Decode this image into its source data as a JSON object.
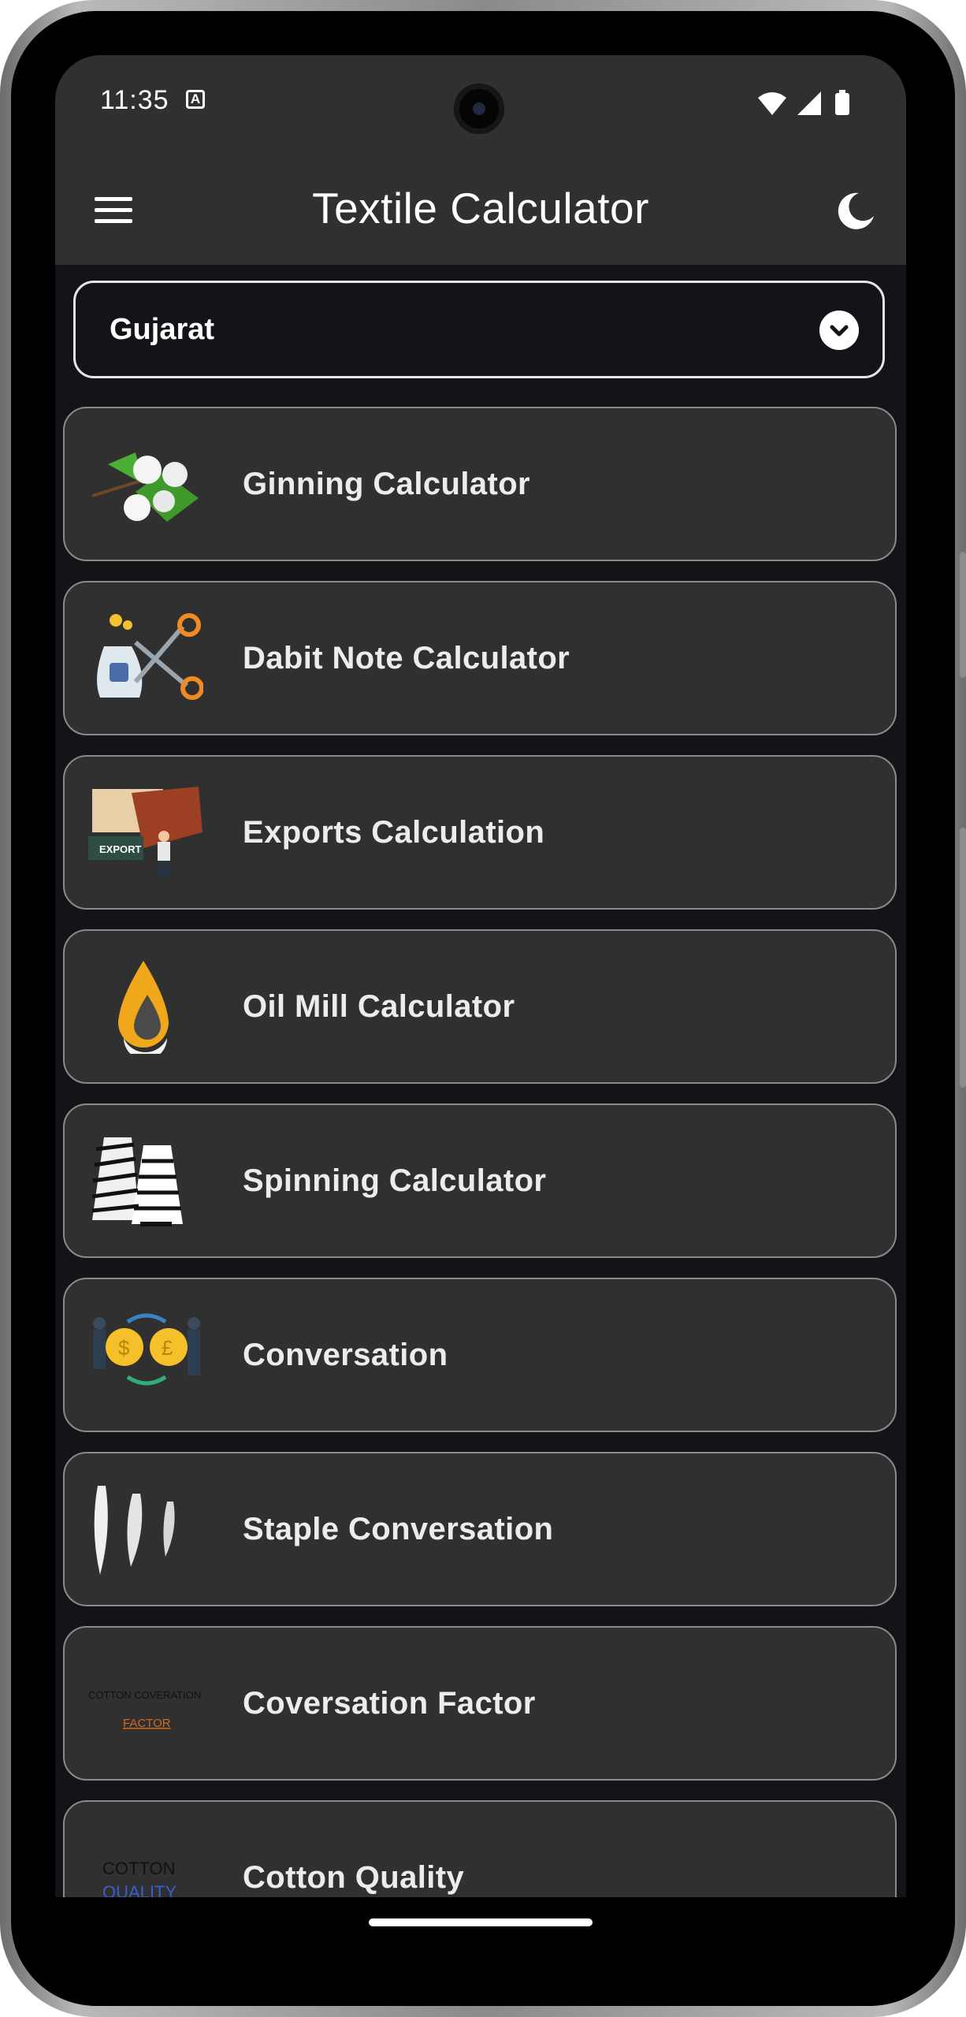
{
  "status_bar": {
    "time": "11:35",
    "notification_badge": "A"
  },
  "app_bar": {
    "title": "Textile Calculator",
    "menu_icon": "hamburger-icon",
    "theme_icon": "moon-icon"
  },
  "dropdown": {
    "selected": "Gujarat",
    "icon": "chevron-down-icon"
  },
  "items": [
    {
      "label": "Ginning Calculator",
      "icon": "cotton-plant-icon"
    },
    {
      "label": "Dabit Note Calculator",
      "icon": "scissors-money-bag-icon"
    },
    {
      "label": "Exports Calculation",
      "icon": "export-container-icon"
    },
    {
      "label": "Oil Mill Calculator",
      "icon": "oil-drop-icon"
    },
    {
      "label": "Spinning Calculator",
      "icon": "yarn-spools-icon"
    },
    {
      "label": "Conversation",
      "icon": "currency-exchange-icon"
    },
    {
      "label": "Staple Conversation",
      "icon": "cotton-staple-icon"
    },
    {
      "label": "Coversation Factor",
      "icon": "conversion-factor-icon",
      "icon_text": [
        "COTTON COVERATION",
        "FACTOR"
      ]
    },
    {
      "label": "Cotton Quality",
      "icon": "cotton-quality-icon",
      "icon_text": [
        "COTTON",
        "QUALITY"
      ]
    }
  ],
  "colors": {
    "app_bar": "#303030",
    "background": "#141317",
    "card": "#303030",
    "card_border": "#8a8a8a"
  }
}
